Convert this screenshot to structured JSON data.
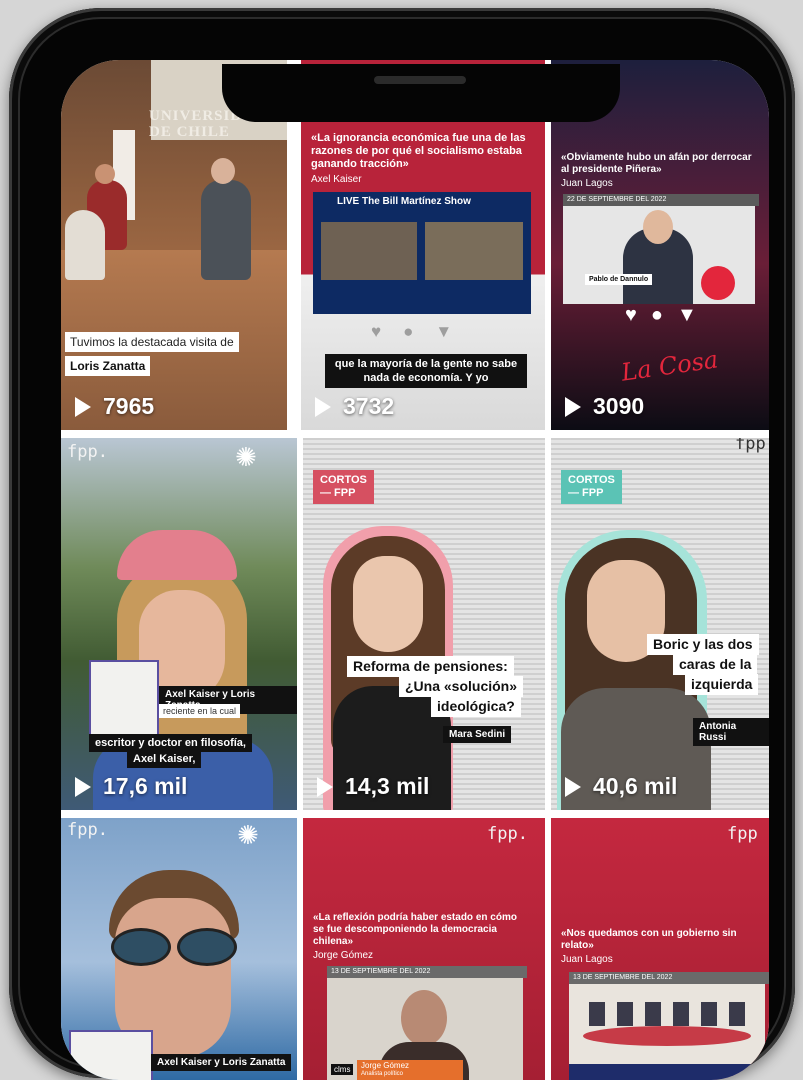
{
  "tiles": [
    {
      "views": "7965",
      "caption_1": "Tuvimos la destacada visita de",
      "caption_2": "Loris Zanatta",
      "sign": "UNIVERSIDAD DE CHILE"
    },
    {
      "views": "3732",
      "quote": "«La ignorancia económica fue una de las razones de por qué el socialismo estaba ganando tracción»",
      "author": "Axel Kaiser",
      "show": "LIVE The Bill Martínez Show",
      "subtitle": "que la mayoría de la gente no sabe nada de economía. Y yo"
    },
    {
      "views": "3090",
      "quote": "«Obviamente hubo un afán por derrocar al presidente Piñera»",
      "author": "Juan Lagos",
      "date": "22 DE SEPTIEMBRE DEL 2022",
      "namecard": "Pablo de Dannulo",
      "brand": "La Cosa"
    },
    {
      "views": "17,6 mil",
      "fpp": "fpp.",
      "name_tag": "Axel Kaiser y Loris Zanatta",
      "book_line": "reciente en la cual",
      "caption_1": "escritor y doctor en filosofía,",
      "caption_2": "Axel Kaiser,"
    },
    {
      "views": "14,3 mil",
      "badge_1": "CORTOS",
      "badge_2": "— FPP",
      "headline_1": "Reforma de pensiones:",
      "headline_2": "¿Una «solución»",
      "headline_3": "ideológica?",
      "name": "Mara Sedini"
    },
    {
      "views": "40,6 mil",
      "badge_1": "CORTOS",
      "badge_2": "— FPP",
      "fpp": "fpp",
      "headline_1": "Boric y las dos",
      "headline_2": "caras de la",
      "headline_3": "izquierda",
      "name": "Antonia Russi"
    },
    {
      "fpp": "fpp.",
      "name_tag": "Axel Kaiser y Loris Zanatta"
    },
    {
      "fpp": "fpp.",
      "quote": "«La reflexión podría haber estado en cómo se fue descomponiendo la democracia chilena»",
      "author": "Jorge Gómez",
      "date": "13 DE SEPTIEMBRE DEL 2022",
      "name_card": "Jorge Gómez",
      "name_sub": "Analista político",
      "logo": "clms"
    },
    {
      "fpp": "fpp",
      "quote": "«Nos quedamos con un gobierno sin relato»",
      "author": "Juan Lagos",
      "date": "13 DE SEPTIEMBRE DEL 2022"
    }
  ],
  "colors": {
    "crimson": "#b8233a",
    "accent": "#d65061",
    "dark": "#111111"
  }
}
